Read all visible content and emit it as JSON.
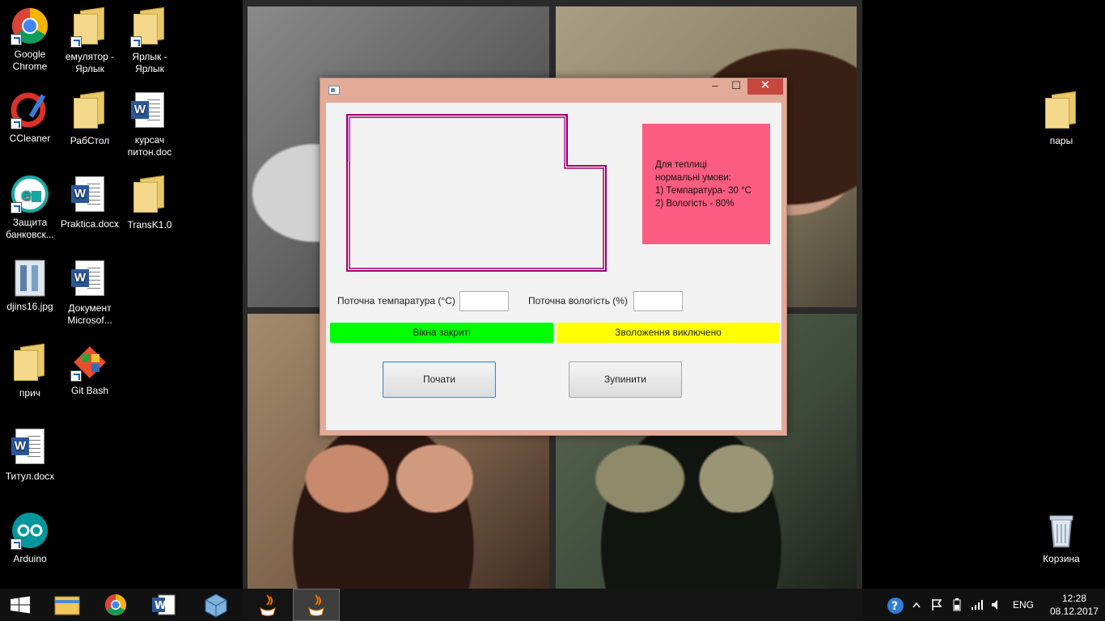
{
  "desktop": {
    "icons": [
      {
        "label": "Google Chrome",
        "icon": "chrome-icon"
      },
      {
        "label": "емулятор - Ярлык",
        "icon": "folder-icon"
      },
      {
        "label": "Ярлык - Ярлык",
        "icon": "folder-icon"
      },
      {
        "label": "CCleaner",
        "icon": "ccleaner-icon"
      },
      {
        "label": "РабСтол",
        "icon": "folder-icon"
      },
      {
        "label": "курсач питон.doc",
        "icon": "word-doc-icon"
      },
      {
        "label": "Защита банковск...",
        "icon": "bank-protection-icon"
      },
      {
        "label": "Praktica.docx",
        "icon": "word-doc-icon"
      },
      {
        "label": "TransK1.0",
        "icon": "folder-icon"
      },
      {
        "label": "djins16.jpg",
        "icon": "image-file-icon"
      },
      {
        "label": "Документ Microsof...",
        "icon": "word-doc-icon"
      },
      {
        "label": "прич",
        "icon": "folder-icon"
      },
      {
        "label": "Git Bash",
        "icon": "git-bash-icon"
      },
      {
        "label": "Титул.docx",
        "icon": "word-doc-icon"
      },
      {
        "label": "Arduino",
        "icon": "arduino-icon"
      },
      {
        "label": "пары",
        "icon": "folder-icon"
      },
      {
        "label": "Корзина",
        "icon": "recycle-bin-icon"
      }
    ]
  },
  "window": {
    "minimize_glyph": "‒",
    "maximize_glyph": "☐",
    "close_glyph": "✕",
    "info_lines": [
      "Для теплиці",
      "нормальні умови:",
      "1) Темпаратура- 30 °C",
      "2) Вологість - 80%"
    ],
    "temp_label": "Поточна темпаратура (°C)",
    "temp_value": "",
    "humidity_label": "Поточна вологість (%)",
    "humidity_value": "",
    "windows_status": "Вікна закриті",
    "humidifier_status": "Зволоження виключено",
    "start_button": "Почати",
    "stop_button": "Зупинити",
    "colors": {
      "frame": "#e3ab97",
      "info_box": "#fb5c80",
      "windows_status_bg": "#00ff00",
      "humidifier_status_bg": "#ffff00",
      "outline_stroke": "#a0006b",
      "outline_highlight": "#cc88ff"
    }
  },
  "taskbar": {
    "items": [
      "start-button",
      "file-explorer",
      "chrome",
      "word",
      "virtualbox",
      "java-app",
      "java-app-active"
    ],
    "language": "ENG",
    "time": "12:28",
    "date": "08.12.2017"
  }
}
